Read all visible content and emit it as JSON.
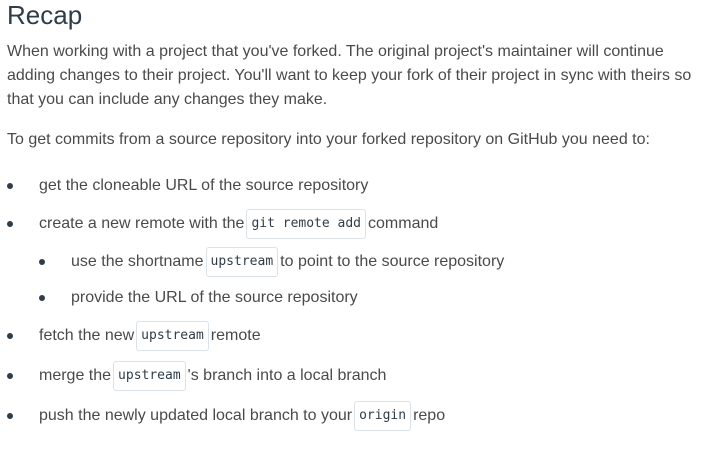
{
  "heading": "Recap",
  "paragraphs": [
    "When working with a project that you've forked. The original project's maintainer will continue adding changes to their project. You'll want to keep your fork of their project in sync with theirs so that you can include any changes they make.",
    "To get commits from a source repository into your forked repository on GitHub you need to:"
  ],
  "steps": {
    "s1": {
      "text": "get the cloneable URL of the source repository"
    },
    "s2": {
      "before": "create a new remote with the",
      "code": "git remote add",
      "after": "command",
      "sub1": {
        "before": "use the shortname",
        "code": "upstream",
        "after": "to point to the source repository"
      },
      "sub2": {
        "text": "provide the URL of the source repository"
      }
    },
    "s3": {
      "before": "fetch the new",
      "code": "upstream",
      "after": "remote"
    },
    "s4": {
      "before": "merge the",
      "code": "upstream",
      "after": "'s branch into a local branch"
    },
    "s5": {
      "before": "push the newly updated local branch to your",
      "code": "origin",
      "after": "repo"
    }
  }
}
